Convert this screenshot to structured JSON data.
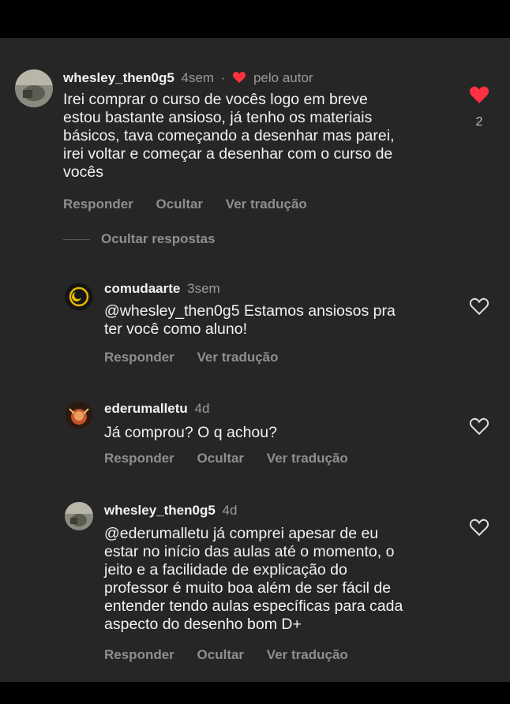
{
  "comments": [
    {
      "username": "whesley_then0g5",
      "time": "4sem",
      "author_label": "pelo autor",
      "text": "Irei comprar o curso de vocês logo em breve\nestou bastante ansioso, já tenho os materiais\nbásicos, tava começando a desenhar mas parei,\nirei voltar e começar a desenhar com o curso de\nvocês",
      "actions": [
        "Responder",
        "Ocultar",
        "Ver tradução"
      ],
      "likes": "2",
      "liked": true
    },
    {
      "username": "comudaarte",
      "time": "3sem",
      "text": "@whesley_then0g5 Estamos ansiosos pra\nter você como aluno!",
      "actions": [
        "Responder",
        "Ver tradução"
      ],
      "liked": false
    },
    {
      "username": "ederumalletu",
      "time": "4d",
      "text": "Já comprou? O q achou?",
      "actions": [
        "Responder",
        "Ocultar",
        "Ver tradução"
      ],
      "liked": false
    },
    {
      "username": "whesley_then0g5",
      "time": "4d",
      "text": "@ederumalletu já comprei apesar de eu\nestar no início das aulas até o momento, o\njeito e a facilidade de explicação do\nprofessor é muito boa além de ser fácil de\nentender tendo aulas específicas para cada\naspecto do desenho bom D+",
      "actions": [
        "Responder",
        "Ocultar",
        "Ver tradução"
      ],
      "liked": false
    }
  ],
  "hide_replies_label": "Ocultar respostas",
  "icons": {
    "liked_heart": "heart-filled-icon",
    "unliked_heart": "heart-outline-icon",
    "author_heart": "heart-small-icon"
  },
  "colors": {
    "background": "#262626",
    "heart_red": "#ff3040",
    "muted_text": "#8e8e8e"
  }
}
